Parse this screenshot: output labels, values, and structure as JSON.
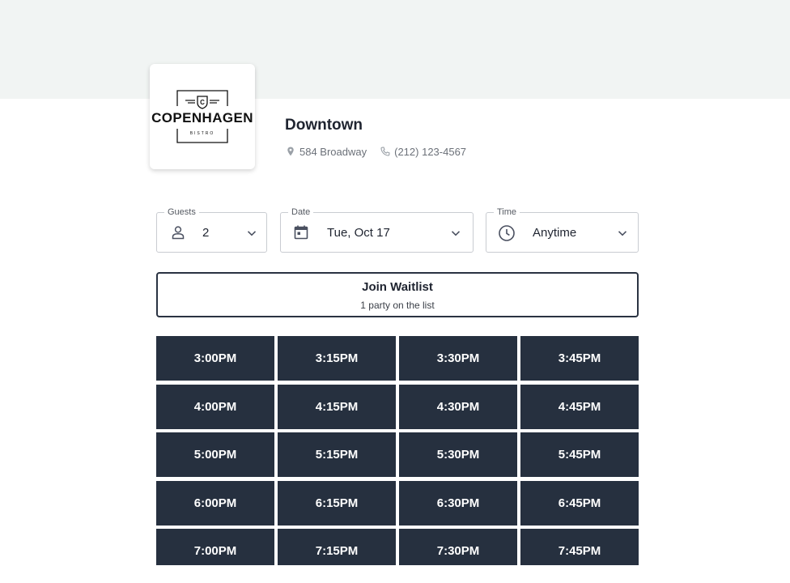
{
  "restaurant": {
    "logo_word": "COPENHAGEN",
    "logo_sub": "BISTRO",
    "logo_badge": "C",
    "location_name": "Downtown",
    "address": "584 Broadway",
    "phone": "(212) 123-4567"
  },
  "search": {
    "guests": {
      "label": "Guests",
      "value": "2"
    },
    "date": {
      "label": "Date",
      "value": "Tue, Oct 17"
    },
    "time": {
      "label": "Time",
      "value": "Anytime"
    }
  },
  "waitlist": {
    "title": "Join Waitlist",
    "subtitle": "1 party on the list"
  },
  "time_slots": [
    "3:00PM",
    "3:15PM",
    "3:30PM",
    "3:45PM",
    "4:00PM",
    "4:15PM",
    "4:30PM",
    "4:45PM",
    "5:00PM",
    "5:15PM",
    "5:30PM",
    "5:45PM",
    "6:00PM",
    "6:15PM",
    "6:30PM",
    "6:45PM",
    "7:00PM",
    "7:15PM",
    "7:30PM",
    "7:45PM"
  ],
  "colors": {
    "slot_bg": "#26303f",
    "slot_text": "#ffffff",
    "header_band": "#f1f4f3",
    "muted_text": "#6b7078"
  },
  "icons": {
    "address": "map-pin-icon",
    "phone": "phone-icon",
    "guests": "person-icon",
    "date": "calendar-icon",
    "time": "clock-icon",
    "dropdown": "chevron-down-icon"
  }
}
